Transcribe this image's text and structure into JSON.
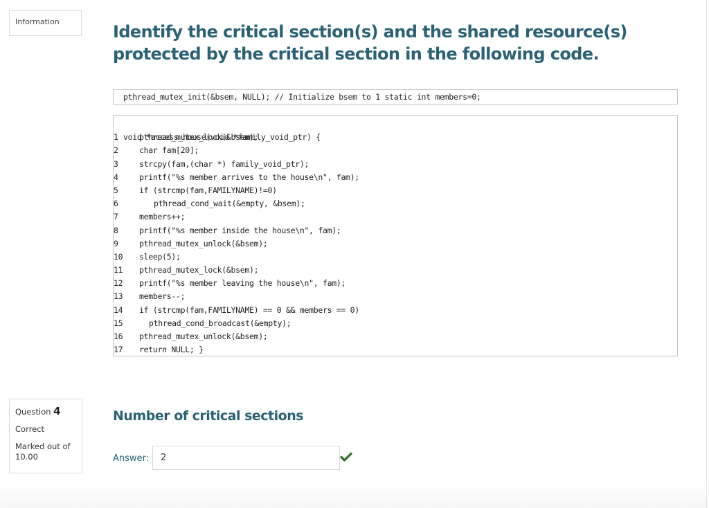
{
  "information_box": {
    "label": "Information"
  },
  "info_question": {
    "title": "Identify the critical section(s) and the shared resource(s) protected by the critical section in the following code.",
    "title_line1": "Identify the critical section(s) and the shared resource(s)",
    "title_line2": "protected by the critical section in the following code.",
    "init_code": "pthread_mutex_init(&bsem, NULL); // Initialize bsem to 1 static int members=0;",
    "code_header": "void *access_house(void *family_void_ptr) {",
    "code_lines": [
      {
        "num": "1",
        "text": "pthread_mutex_lock(&bsem);"
      },
      {
        "num": "2",
        "text": "char fam[20];"
      },
      {
        "num": "3",
        "text": "strcpy(fam,(char *) family_void_ptr);"
      },
      {
        "num": "4",
        "text": "printf(\"%s member arrives to the house\\n\", fam);"
      },
      {
        "num": "5",
        "text": "if (strcmp(fam,FAMILYNAME)!=0)"
      },
      {
        "num": "6",
        "text": "pthread_cond_wait(&empty, &bsem);"
      },
      {
        "num": "7",
        "text": "members++;"
      },
      {
        "num": "8",
        "text": "printf(\"%s member inside the house\\n\", fam);"
      },
      {
        "num": "9",
        "text": "pthread_mutex_unlock(&bsem);"
      },
      {
        "num": "10",
        "text": "sleep(5);"
      },
      {
        "num": "11",
        "text": "pthread_mutex_lock(&bsem);"
      },
      {
        "num": "12",
        "text": "printf(\"%s member leaving the house\\n\", fam);"
      },
      {
        "num": "13",
        "text": "members--;"
      },
      {
        "num": "14",
        "text": "if (strcmp(fam,FAMILYNAME) == 0 && members == 0)"
      },
      {
        "num": "15",
        "text": "pthread_cond_broadcast(&empty);"
      },
      {
        "num": "16",
        "text": "pthread_mutex_unlock(&bsem);"
      },
      {
        "num": "17",
        "text": "return NULL; }"
      }
    ]
  },
  "question": {
    "label": "Question",
    "number": "4",
    "status": "Correct",
    "marked_out_of_label": "Marked out of",
    "max_mark": "10.00",
    "prompt": "Number of critical sections",
    "answer_label": "Answer:",
    "answer_value": "2",
    "result_icon": "check-icon",
    "result_color": "#2e6b2a"
  },
  "colors": {
    "heading": "#2a6175",
    "border": "#c4c4c4"
  }
}
